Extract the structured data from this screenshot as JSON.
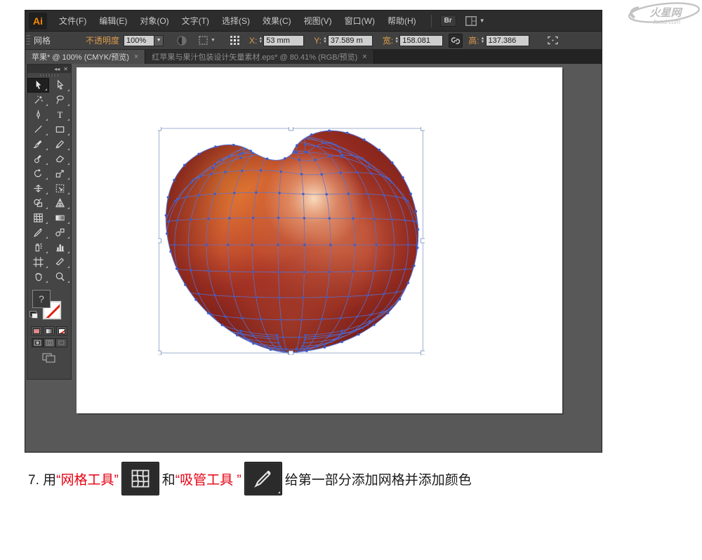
{
  "watermark": {
    "brand": "火星网",
    "domain": "hxsd.com"
  },
  "menu_bar": {
    "logo": "Ai",
    "items": [
      "文件(F)",
      "编辑(E)",
      "对象(O)",
      "文字(T)",
      "选择(S)",
      "效果(C)",
      "视图(V)",
      "窗口(W)",
      "帮助(H)"
    ],
    "bridge_button": "Br"
  },
  "options_bar": {
    "tool_label": "网格",
    "opacity_label": "不透明度",
    "opacity_value": "100%",
    "x_label": "X:",
    "x_value": "53 mm",
    "y_label": "Y:",
    "y_value": "37.589 m",
    "w_label": "宽:",
    "w_value": "158.081",
    "h_label": "高:",
    "h_value": "137.386",
    "icons": [
      "opacity-ball-icon",
      "style-picker-icon",
      "reference-point-icon",
      "link-icon",
      "constrain-icon"
    ]
  },
  "tabs": [
    {
      "title": "苹果* @ 100% (CMYK/预览)",
      "close": "×",
      "active": true
    },
    {
      "title": "红苹果与果汁包装设计矢量素材.eps* @ 80.41% (RGB/预览)",
      "close": "×",
      "active": false
    }
  ],
  "toolbox": {
    "collapse_glyph": "◂◂",
    "close_glyph": "✕",
    "fill_placeholder": "?",
    "tools": [
      {
        "name": "selection",
        "active": true
      },
      {
        "name": "direct-selection",
        "active": false
      },
      {
        "name": "magic-wand",
        "active": false
      },
      {
        "name": "lasso",
        "active": false
      },
      {
        "name": "pen",
        "active": false
      },
      {
        "name": "type",
        "active": false
      },
      {
        "name": "line-segment",
        "active": false
      },
      {
        "name": "rectangle",
        "active": false
      },
      {
        "name": "paintbrush",
        "active": false
      },
      {
        "name": "pencil",
        "active": false
      },
      {
        "name": "blob-brush",
        "active": false
      },
      {
        "name": "eraser",
        "active": false
      },
      {
        "name": "rotate",
        "active": false
      },
      {
        "name": "scale",
        "active": false
      },
      {
        "name": "width",
        "active": false
      },
      {
        "name": "free-transform",
        "active": false
      },
      {
        "name": "shape-builder",
        "active": false
      },
      {
        "name": "perspective-grid",
        "active": false
      },
      {
        "name": "mesh",
        "active": false
      },
      {
        "name": "gradient",
        "active": false
      },
      {
        "name": "eyedropper",
        "active": false
      },
      {
        "name": "blend",
        "active": false
      },
      {
        "name": "symbol-sprayer",
        "active": false
      },
      {
        "name": "column-graph",
        "active": false
      },
      {
        "name": "artboard",
        "active": false
      },
      {
        "name": "slice",
        "active": false
      },
      {
        "name": "hand",
        "active": false
      },
      {
        "name": "zoom",
        "active": false
      }
    ]
  },
  "caption": {
    "prefix": "7. 用",
    "tool1": "“网格工具”",
    "conjunction": "和",
    "tool2": "“吸管工具 ”",
    "suffix": "给第一部分添加网格并添加颜色",
    "inline_icons": [
      "mesh-tool-icon",
      "eyedropper-tool-icon"
    ]
  },
  "colors": {
    "caption_red": "#e60012",
    "accent_orange": "#dd9c4b",
    "mesh_blue": "#5b74d4",
    "mesh_node_blue": "#3c5ccc",
    "canvas_gray": "#585858",
    "apple_base": "#b23a29",
    "apple_highlight": "#fbe3c4",
    "apple_orange": "#ef8a33",
    "apple_dark_edge": "#7e211a"
  }
}
